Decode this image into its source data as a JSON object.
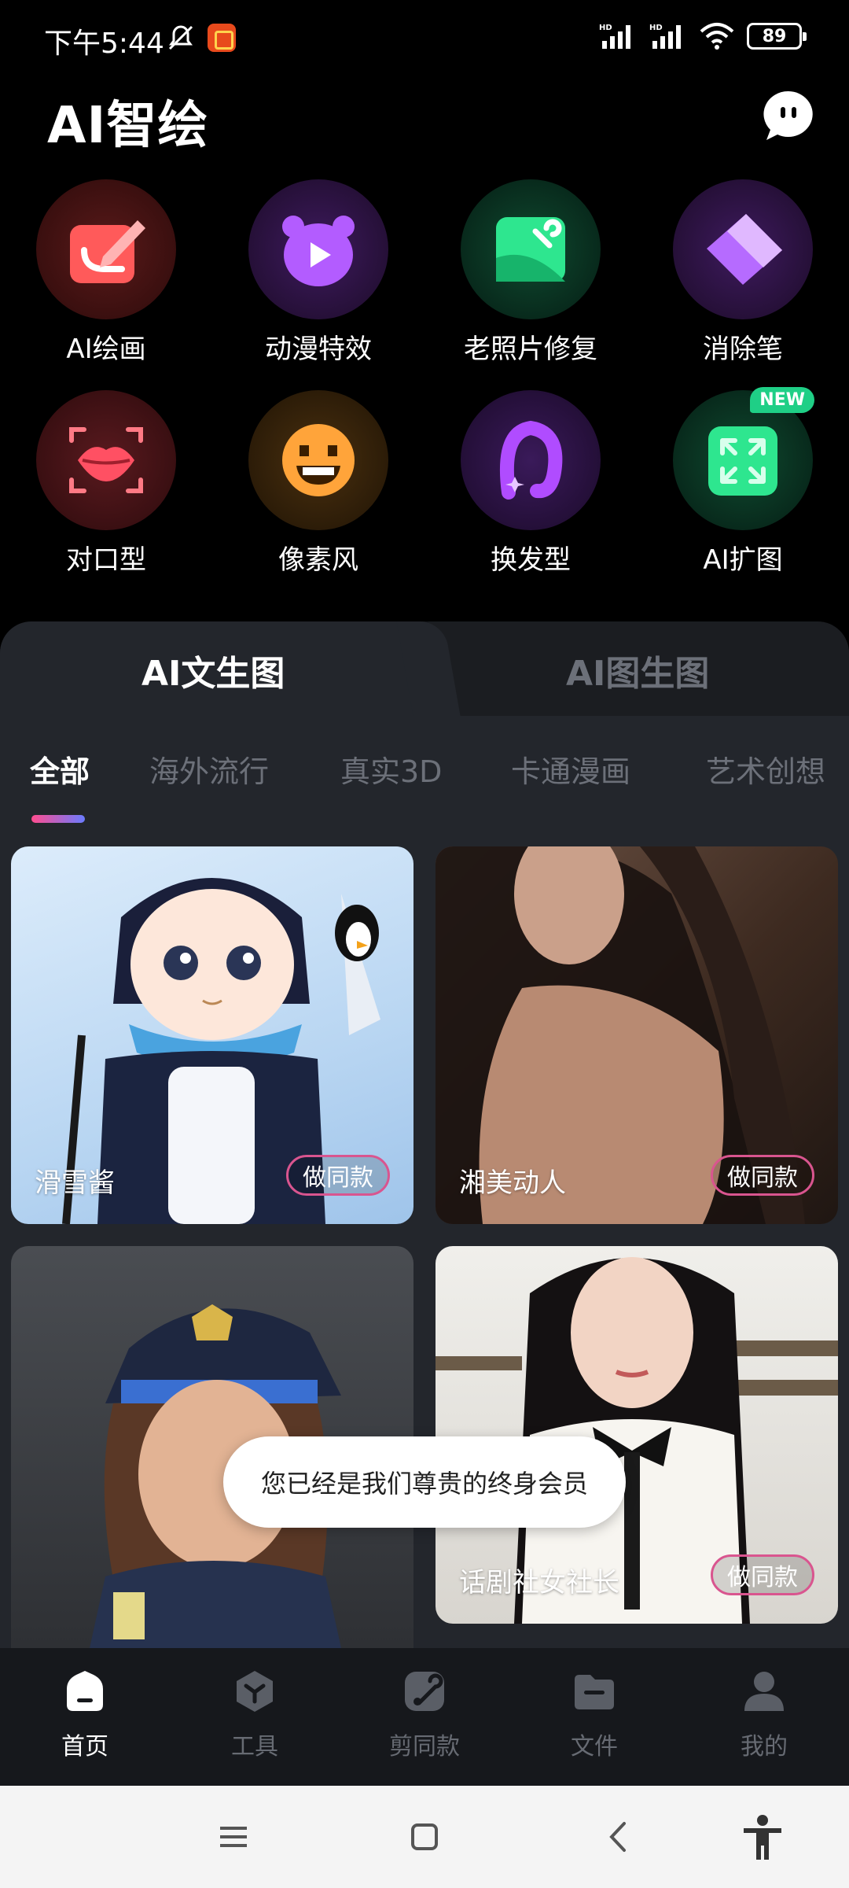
{
  "status_bar": {
    "time": "下午5:44",
    "network_1": "HD",
    "network_2": "HD",
    "battery": "89"
  },
  "header": {
    "title": "AI智绘"
  },
  "tools": [
    {
      "label": "AI绘画",
      "icon": "ai-paint-icon",
      "color": "#ff5a5a"
    },
    {
      "label": "动漫特效",
      "icon": "anime-bear-icon",
      "color": "#b35cff"
    },
    {
      "label": "老照片修复",
      "icon": "photo-repair-icon",
      "color": "#2ee68f"
    },
    {
      "label": "消除笔",
      "icon": "eraser-icon",
      "color": "#b66bff"
    },
    {
      "label": "对口型",
      "icon": "lips-icon",
      "color": "#ff5063"
    },
    {
      "label": "像素风",
      "icon": "pixel-face-icon",
      "color": "#ffa43a"
    },
    {
      "label": "换发型",
      "icon": "hair-icon",
      "color": "#b04cff"
    },
    {
      "label": "AI扩图",
      "icon": "expand-icon",
      "color": "#2ee68f",
      "badge": "NEW"
    }
  ],
  "main_tabs": {
    "active": "AI文生图",
    "inactive": "AI图生图"
  },
  "categories": [
    "全部",
    "海外流行",
    "真实3D",
    "卡通漫画",
    "艺术创想"
  ],
  "cards": [
    {
      "title": "滑雪酱",
      "button": "做同款"
    },
    {
      "title": "湘美动人",
      "button": "做同款"
    },
    {
      "title": "",
      "button": ""
    },
    {
      "title": "话剧社女社长",
      "button": "做同款"
    }
  ],
  "toast": "您已经是我们尊贵的终身会员",
  "bottom_nav": [
    {
      "label": "首页",
      "icon": "home-icon",
      "active": true
    },
    {
      "label": "工具",
      "icon": "tools-icon",
      "active": false
    },
    {
      "label": "剪同款",
      "icon": "clip-template-icon",
      "active": false
    },
    {
      "label": "文件",
      "icon": "folder-icon",
      "active": false
    },
    {
      "label": "我的",
      "icon": "profile-icon",
      "active": false
    }
  ],
  "colors": {
    "accent_pink": "#ff4d8f",
    "accent_blue": "#6a7bff",
    "panel": "#23262c",
    "inactive_text": "#6c7079"
  }
}
